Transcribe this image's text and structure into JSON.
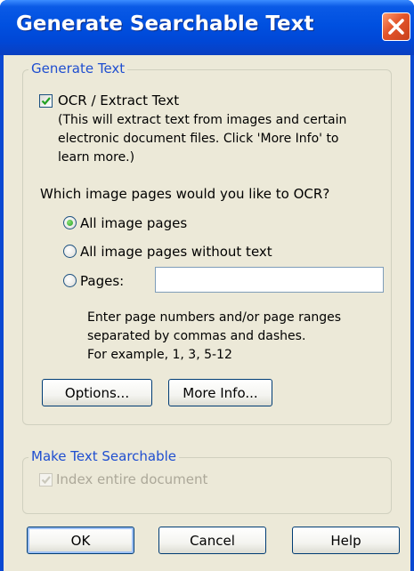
{
  "window": {
    "title": "Generate Searchable Text"
  },
  "generate_text": {
    "legend": "Generate Text",
    "ocr_checkbox": {
      "label": "OCR / Extract Text",
      "checked": true
    },
    "ocr_note": [
      "(This will extract text from images and certain",
      "electronic document files.  Click 'More Info' to",
      "learn more.)"
    ],
    "question": "Which image pages would you like to OCR?",
    "radio_options": [
      {
        "label": "All image pages",
        "selected": true
      },
      {
        "label": "All image pages without text",
        "selected": false
      },
      {
        "label": "Pages:",
        "selected": false
      }
    ],
    "pages_input": {
      "value": "",
      "placeholder": ""
    },
    "pages_help": [
      "Enter page numbers and/or page ranges",
      "separated by commas and dashes.",
      "For example, 1, 3, 5-12"
    ],
    "options_button": "Options...",
    "more_info_button": "More Info..."
  },
  "make_searchable": {
    "legend": "Make Text Searchable",
    "index_checkbox": {
      "label": "Index entire document",
      "checked": true,
      "enabled": false
    }
  },
  "footer": {
    "ok_label": "OK",
    "cancel_label": "Cancel",
    "help_label": "Help"
  },
  "colors": {
    "title_bar": "#0050e0",
    "dialog_bg": "#ece9d8",
    "group_legend": "#1f4ed0",
    "close_button": "#e2542a",
    "disabled_text": "#aca899"
  }
}
